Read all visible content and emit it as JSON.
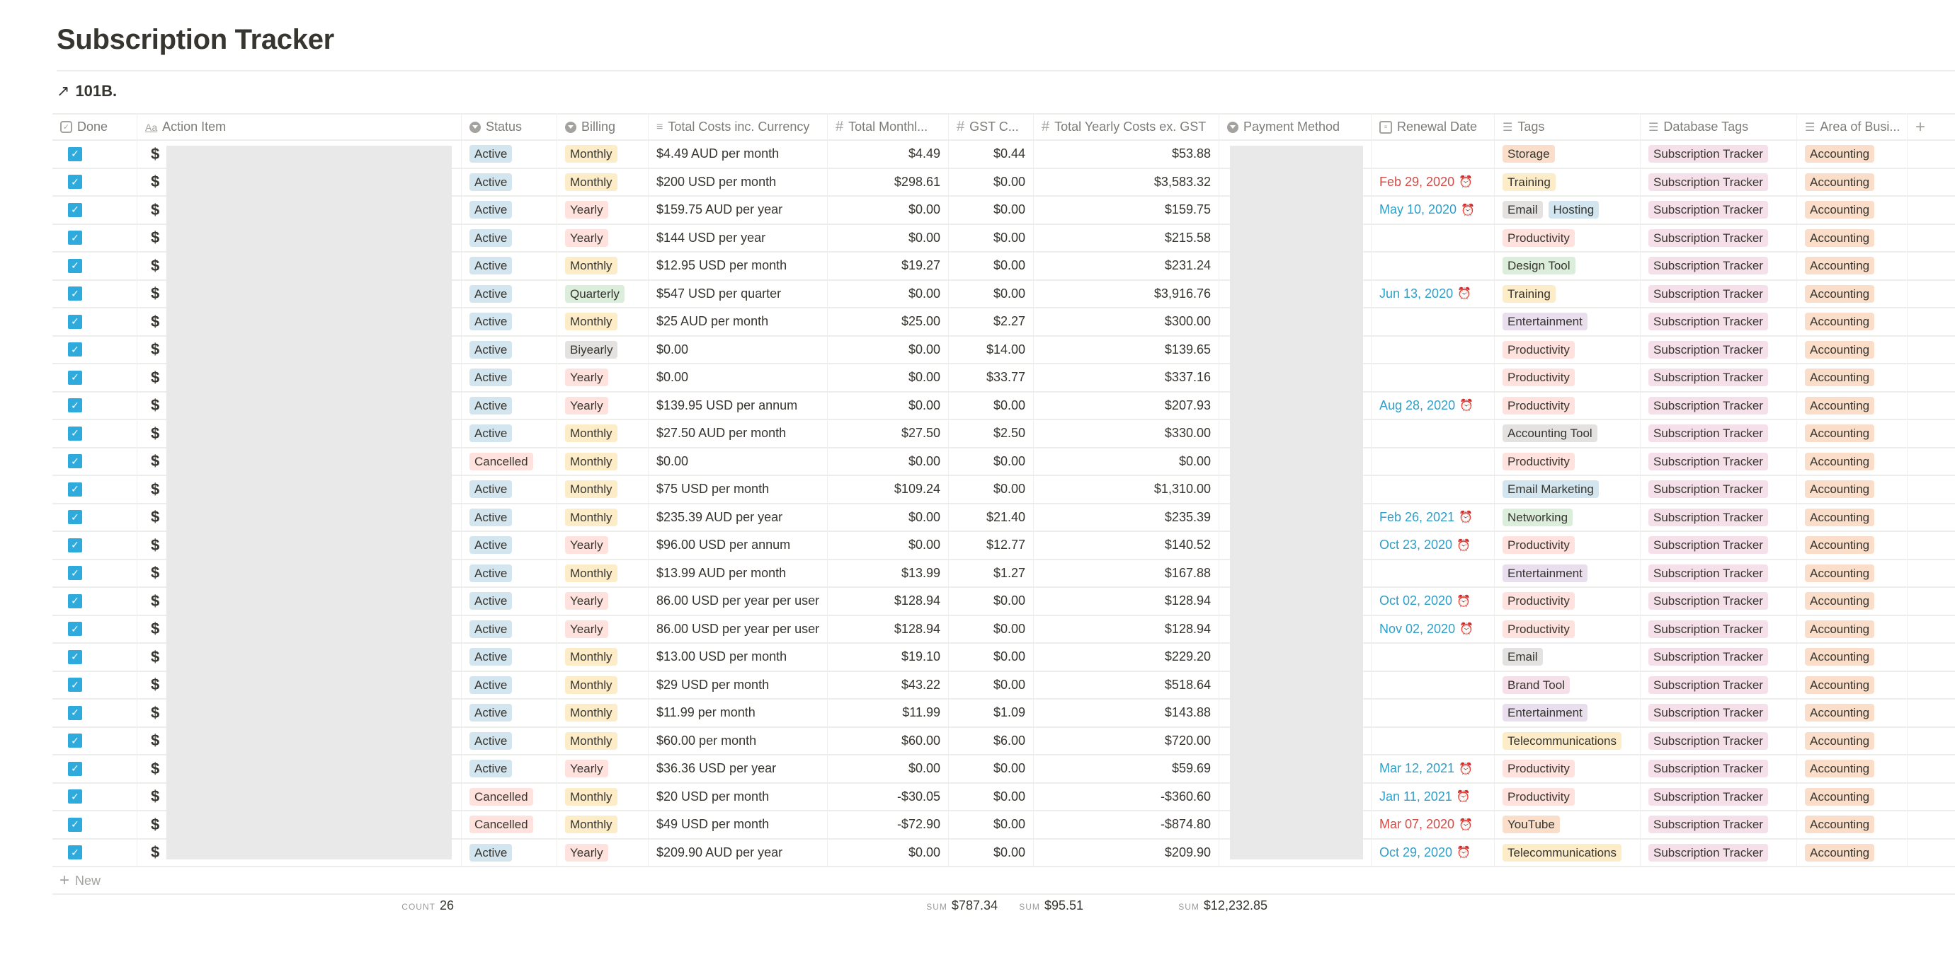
{
  "page": {
    "title": "Subscription Tracker",
    "linked_database": {
      "icon": "arrow-up-right-icon",
      "name": "101B."
    }
  },
  "columns": [
    {
      "key": "done",
      "label": "Done",
      "icon": "checkbox-icon"
    },
    {
      "key": "action_item",
      "label": "Action Item",
      "icon": "title-aa-icon"
    },
    {
      "key": "status",
      "label": "Status",
      "icon": "select-icon"
    },
    {
      "key": "billing",
      "label": "Billing",
      "icon": "select-icon"
    },
    {
      "key": "total_costs",
      "label": "Total Costs inc. Currency",
      "icon": "text-icon"
    },
    {
      "key": "total_monthly",
      "label": "Total Monthl...",
      "icon": "number-icon"
    },
    {
      "key": "gst",
      "label": "GST C...",
      "icon": "number-icon"
    },
    {
      "key": "total_yearly",
      "label": "Total Yearly Costs ex. GST",
      "icon": "number-icon"
    },
    {
      "key": "payment_method",
      "label": "Payment Method",
      "icon": "select-icon"
    },
    {
      "key": "renewal_date",
      "label": "Renewal Date",
      "icon": "calendar-icon"
    },
    {
      "key": "tags",
      "label": "Tags",
      "icon": "multi-select-icon"
    },
    {
      "key": "database_tags",
      "label": "Database Tags",
      "icon": "multi-select-icon"
    },
    {
      "key": "area",
      "label": "Area of Busi...",
      "icon": "multi-select-icon"
    }
  ],
  "add_column_label": "+",
  "rows": [
    {
      "done": true,
      "status": "Active",
      "billing": "Monthly",
      "total_costs": "$4.49 AUD per month",
      "total_monthly": "$4.49",
      "gst": "$0.44",
      "total_yearly": "$53.88",
      "renewal_date": "",
      "renewal_state": "",
      "tags": [
        [
          "Storage",
          "orange"
        ]
      ],
      "database_tags": "Subscription Tracker",
      "area": "Accounting"
    },
    {
      "done": true,
      "status": "Active",
      "billing": "Monthly",
      "total_costs": "$200 USD per month",
      "total_monthly": "$298.61",
      "gst": "$0.00",
      "total_yearly": "$3,583.32",
      "renewal_date": "Feb 29, 2020",
      "renewal_state": "overdue",
      "tags": [
        [
          "Training",
          "yellow"
        ]
      ],
      "database_tags": "Subscription Tracker",
      "area": "Accounting"
    },
    {
      "done": true,
      "status": "Active",
      "billing": "Yearly",
      "total_costs": "$159.75 AUD per year",
      "total_monthly": "$0.00",
      "gst": "$0.00",
      "total_yearly": "$159.75",
      "renewal_date": "May 10, 2020",
      "renewal_state": "upcoming",
      "tags": [
        [
          "Email",
          "gray"
        ],
        [
          "Hosting",
          "blue"
        ]
      ],
      "database_tags": "Subscription Tracker",
      "area": "Accounting"
    },
    {
      "done": true,
      "status": "Active",
      "billing": "Yearly",
      "total_costs": "$144 USD per year",
      "total_monthly": "$0.00",
      "gst": "$0.00",
      "total_yearly": "$215.58",
      "renewal_date": "",
      "renewal_state": "",
      "tags": [
        [
          "Productivity",
          "red"
        ]
      ],
      "database_tags": "Subscription Tracker",
      "area": "Accounting"
    },
    {
      "done": true,
      "status": "Active",
      "billing": "Monthly",
      "total_costs": "$12.95 USD per month",
      "total_monthly": "$19.27",
      "gst": "$0.00",
      "total_yearly": "$231.24",
      "renewal_date": "",
      "renewal_state": "",
      "tags": [
        [
          "Design Tool",
          "green"
        ]
      ],
      "database_tags": "Subscription Tracker",
      "area": "Accounting"
    },
    {
      "done": true,
      "status": "Active",
      "billing": "Quarterly",
      "total_costs": "$547 USD per quarter",
      "total_monthly": "$0.00",
      "gst": "$0.00",
      "total_yearly": "$3,916.76",
      "renewal_date": "Jun 13, 2020",
      "renewal_state": "upcoming",
      "tags": [
        [
          "Training",
          "yellow"
        ]
      ],
      "database_tags": "Subscription Tracker",
      "area": "Accounting"
    },
    {
      "done": true,
      "status": "Active",
      "billing": "Monthly",
      "total_costs": "$25 AUD per month",
      "total_monthly": "$25.00",
      "gst": "$2.27",
      "total_yearly": "$300.00",
      "renewal_date": "",
      "renewal_state": "",
      "tags": [
        [
          "Entertainment",
          "purple"
        ]
      ],
      "database_tags": "Subscription Tracker",
      "area": "Accounting"
    },
    {
      "done": true,
      "status": "Active",
      "billing": "Biyearly",
      "total_costs": "$0.00",
      "total_monthly": "$0.00",
      "gst": "$14.00",
      "total_yearly": "$139.65",
      "renewal_date": "",
      "renewal_state": "",
      "tags": [
        [
          "Productivity",
          "red"
        ]
      ],
      "database_tags": "Subscription Tracker",
      "area": "Accounting"
    },
    {
      "done": true,
      "status": "Active",
      "billing": "Yearly",
      "total_costs": "$0.00",
      "total_monthly": "$0.00",
      "gst": "$33.77",
      "total_yearly": "$337.16",
      "renewal_date": "",
      "renewal_state": "",
      "tags": [
        [
          "Productivity",
          "red"
        ]
      ],
      "database_tags": "Subscription Tracker",
      "area": "Accounting"
    },
    {
      "done": true,
      "status": "Active",
      "billing": "Yearly",
      "total_costs": "$139.95 USD per annum",
      "total_monthly": "$0.00",
      "gst": "$0.00",
      "total_yearly": "$207.93",
      "renewal_date": "Aug 28, 2020",
      "renewal_state": "upcoming",
      "tags": [
        [
          "Productivity",
          "red"
        ]
      ],
      "database_tags": "Subscription Tracker",
      "area": "Accounting"
    },
    {
      "done": true,
      "status": "Active",
      "billing": "Monthly",
      "total_costs": "$27.50 AUD per month",
      "total_monthly": "$27.50",
      "gst": "$2.50",
      "total_yearly": "$330.00",
      "renewal_date": "",
      "renewal_state": "",
      "tags": [
        [
          "Accounting Tool",
          "gray"
        ]
      ],
      "database_tags": "Subscription Tracker",
      "area": "Accounting"
    },
    {
      "done": true,
      "status": "Cancelled",
      "billing": "Monthly",
      "total_costs": "$0.00",
      "total_monthly": "$0.00",
      "gst": "$0.00",
      "total_yearly": "$0.00",
      "renewal_date": "",
      "renewal_state": "",
      "tags": [
        [
          "Productivity",
          "red"
        ]
      ],
      "database_tags": "Subscription Tracker",
      "area": "Accounting"
    },
    {
      "done": true,
      "status": "Active",
      "billing": "Monthly",
      "total_costs": "$75 USD per month",
      "total_monthly": "$109.24",
      "gst": "$0.00",
      "total_yearly": "$1,310.00",
      "renewal_date": "",
      "renewal_state": "",
      "tags": [
        [
          "Email Marketing",
          "blue"
        ]
      ],
      "database_tags": "Subscription Tracker",
      "area": "Accounting"
    },
    {
      "done": true,
      "status": "Active",
      "billing": "Monthly",
      "total_costs": "$235.39 AUD per year",
      "total_monthly": "$0.00",
      "gst": "$21.40",
      "total_yearly": "$235.39",
      "renewal_date": "Feb 26, 2021",
      "renewal_state": "upcoming",
      "tags": [
        [
          "Networking",
          "green"
        ]
      ],
      "database_tags": "Subscription Tracker",
      "area": "Accounting"
    },
    {
      "done": true,
      "status": "Active",
      "billing": "Yearly",
      "total_costs": "$96.00 USD per annum",
      "total_monthly": "$0.00",
      "gst": "$12.77",
      "total_yearly": "$140.52",
      "renewal_date": "Oct 23, 2020",
      "renewal_state": "upcoming",
      "tags": [
        [
          "Productivity",
          "red"
        ]
      ],
      "database_tags": "Subscription Tracker",
      "area": "Accounting"
    },
    {
      "done": true,
      "status": "Active",
      "billing": "Monthly",
      "total_costs": "$13.99 AUD per month",
      "total_monthly": "$13.99",
      "gst": "$1.27",
      "total_yearly": "$167.88",
      "renewal_date": "",
      "renewal_state": "",
      "tags": [
        [
          "Entertainment",
          "purple"
        ]
      ],
      "database_tags": "Subscription Tracker",
      "area": "Accounting"
    },
    {
      "done": true,
      "status": "Active",
      "billing": "Yearly",
      "total_costs": "86.00 USD per year per user",
      "total_monthly": "$128.94",
      "gst": "$0.00",
      "total_yearly": "$128.94",
      "renewal_date": "Oct 02, 2020",
      "renewal_state": "upcoming",
      "tags": [
        [
          "Productivity",
          "red"
        ]
      ],
      "database_tags": "Subscription Tracker",
      "area": "Accounting"
    },
    {
      "done": true,
      "status": "Active",
      "billing": "Yearly",
      "total_costs": "86.00 USD per year per user",
      "total_monthly": "$128.94",
      "gst": "$0.00",
      "total_yearly": "$128.94",
      "renewal_date": "Nov 02, 2020",
      "renewal_state": "upcoming",
      "tags": [
        [
          "Productivity",
          "red"
        ]
      ],
      "database_tags": "Subscription Tracker",
      "area": "Accounting"
    },
    {
      "done": true,
      "status": "Active",
      "billing": "Monthly",
      "total_costs": "$13.00 USD per month",
      "total_monthly": "$19.10",
      "gst": "$0.00",
      "total_yearly": "$229.20",
      "renewal_date": "",
      "renewal_state": "",
      "tags": [
        [
          "Email",
          "gray"
        ]
      ],
      "database_tags": "Subscription Tracker",
      "area": "Accounting"
    },
    {
      "done": true,
      "status": "Active",
      "billing": "Monthly",
      "total_costs": "$29 USD per month",
      "total_monthly": "$43.22",
      "gst": "$0.00",
      "total_yearly": "$518.64",
      "renewal_date": "",
      "renewal_state": "",
      "tags": [
        [
          "Brand Tool",
          "pink"
        ]
      ],
      "database_tags": "Subscription Tracker",
      "area": "Accounting"
    },
    {
      "done": true,
      "status": "Active",
      "billing": "Monthly",
      "total_costs": "$11.99 per month",
      "total_monthly": "$11.99",
      "gst": "$1.09",
      "total_yearly": "$143.88",
      "renewal_date": "",
      "renewal_state": "",
      "tags": [
        [
          "Entertainment",
          "purple"
        ]
      ],
      "database_tags": "Subscription Tracker",
      "area": "Accounting"
    },
    {
      "done": true,
      "status": "Active",
      "billing": "Monthly",
      "total_costs": "$60.00 per month",
      "total_monthly": "$60.00",
      "gst": "$6.00",
      "total_yearly": "$720.00",
      "renewal_date": "",
      "renewal_state": "",
      "tags": [
        [
          "Telecommunications",
          "yellow"
        ]
      ],
      "database_tags": "Subscription Tracker",
      "area": "Accounting"
    },
    {
      "done": true,
      "status": "Active",
      "billing": "Yearly",
      "total_costs": "$36.36 USD per year",
      "total_monthly": "$0.00",
      "gst": "$0.00",
      "total_yearly": "$59.69",
      "renewal_date": "Mar 12, 2021",
      "renewal_state": "upcoming",
      "tags": [
        [
          "Productivity",
          "red"
        ]
      ],
      "database_tags": "Subscription Tracker",
      "area": "Accounting"
    },
    {
      "done": true,
      "status": "Cancelled",
      "billing": "Monthly",
      "total_costs": "$20 USD per month",
      "total_monthly": "-$30.05",
      "gst": "$0.00",
      "total_yearly": "-$360.60",
      "renewal_date": "Jan 11, 2021",
      "renewal_state": "upcoming",
      "tags": [
        [
          "Productivity",
          "red"
        ]
      ],
      "database_tags": "Subscription Tracker",
      "area": "Accounting"
    },
    {
      "done": true,
      "status": "Cancelled",
      "billing": "Monthly",
      "total_costs": "$49 USD per month",
      "total_monthly": "-$72.90",
      "gst": "$0.00",
      "total_yearly": "-$874.80",
      "renewal_date": "Mar 07, 2020",
      "renewal_state": "overdue",
      "tags": [
        [
          "YouTube",
          "orange"
        ]
      ],
      "database_tags": "Subscription Tracker",
      "area": "Accounting"
    },
    {
      "done": true,
      "status": "Active",
      "billing": "Yearly",
      "total_costs": "$209.90 AUD per year",
      "total_monthly": "$0.00",
      "gst": "$0.00",
      "total_yearly": "$209.90",
      "renewal_date": "Oct 29, 2020",
      "renewal_state": "upcoming",
      "tags": [
        [
          "Telecommunications",
          "yellow"
        ]
      ],
      "database_tags": "Subscription Tracker",
      "area": "Accounting"
    }
  ],
  "row_icon": "dollar-icon",
  "new_row_label": "New",
  "footer": {
    "count_label": "COUNT",
    "count_value": "26",
    "sum_label": "SUM",
    "sum_monthly": "$787.34",
    "sum_gst": "$95.51",
    "sum_yearly": "$12,232.85"
  },
  "colors": {
    "checkbox": "#2eaadc",
    "date_overdue": "#d44c47",
    "date_upcoming": "#2e9fc9",
    "status_active": "#d3e5ef",
    "status_cancelled": "#ffe2dd"
  }
}
